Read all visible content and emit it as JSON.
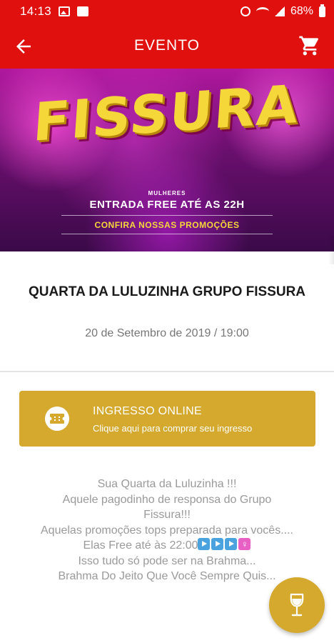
{
  "status_bar": {
    "time": "14:13",
    "battery": "68%"
  },
  "app_bar": {
    "title": "EVENTO",
    "back_icon": "arrow-left-icon",
    "cart_icon": "shopping-cart-icon"
  },
  "banner": {
    "title": "FISSURA",
    "sub_small": "MULHERES",
    "sub_main": "ENTRADA FREE ATÉ AS 22H",
    "promo": "CONFIRA NOSSAS PROMOÇÕES"
  },
  "event": {
    "title": "QUARTA DA LULUZINHA GRUPO FISSURA",
    "date": "20 de Setembro de 2019 / 19:00"
  },
  "ticket": {
    "label": "INGRESSO ONLINE",
    "sub": "Clique aqui para comprar seu ingresso",
    "icon": "ticket-icon"
  },
  "description": {
    "lines": [
      "Sua Quarta da Luluzinha !!!",
      "Aquele pagodinho de responsa do Grupo",
      "Fissura!!!",
      "Aquelas promoções tops preparada para vocês....",
      "Elas Free até às 22:00",
      "Isso tudo só pode ser na Brahma...",
      "Brahma Do Jeito Que Você Sempre Quis..."
    ]
  },
  "fab": {
    "icon": "wine-glass-icon"
  },
  "colors": {
    "primary_red": "#e0100f",
    "gold": "#d4a92e"
  }
}
